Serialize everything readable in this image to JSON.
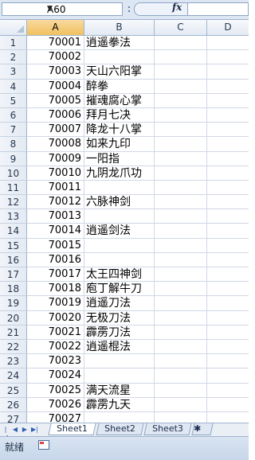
{
  "name_box": {
    "value": "A60"
  },
  "formula_bar": {
    "fx_label": "fx",
    "value": ""
  },
  "columns": [
    "A",
    "B",
    "C",
    "D"
  ],
  "selected_column": "A",
  "rows": [
    {
      "num": "1",
      "a": "70001",
      "b": "逍遥拳法"
    },
    {
      "num": "2",
      "a": "70002",
      "b": ""
    },
    {
      "num": "3",
      "a": "70003",
      "b": "天山六阳掌"
    },
    {
      "num": "4",
      "a": "70004",
      "b": "醉拳"
    },
    {
      "num": "5",
      "a": "70005",
      "b": "摧魂腐心掌"
    },
    {
      "num": "6",
      "a": "70006",
      "b": "拜月七决"
    },
    {
      "num": "7",
      "a": "70007",
      "b": "降龙十八掌"
    },
    {
      "num": "8",
      "a": "70008",
      "b": "如来九印"
    },
    {
      "num": "9",
      "a": "70009",
      "b": "一阳指"
    },
    {
      "num": "10",
      "a": "70010",
      "b": "九阴龙爪功"
    },
    {
      "num": "11",
      "a": "70011",
      "b": ""
    },
    {
      "num": "12",
      "a": "70012",
      "b": "六脉神剑"
    },
    {
      "num": "13",
      "a": "70013",
      "b": ""
    },
    {
      "num": "14",
      "a": "70014",
      "b": "逍遥剑法"
    },
    {
      "num": "15",
      "a": "70015",
      "b": ""
    },
    {
      "num": "16",
      "a": "70016",
      "b": ""
    },
    {
      "num": "17",
      "a": "70017",
      "b": "太王四神剑"
    },
    {
      "num": "18",
      "a": "70018",
      "b": "庖丁解牛刀"
    },
    {
      "num": "19",
      "a": "70019",
      "b": "逍遥刀法"
    },
    {
      "num": "20",
      "a": "70020",
      "b": "无极刀法"
    },
    {
      "num": "21",
      "a": "70021",
      "b": "霹雳刀法"
    },
    {
      "num": "22",
      "a": "70022",
      "b": "逍遥棍法"
    },
    {
      "num": "23",
      "a": "70023",
      "b": ""
    },
    {
      "num": "24",
      "a": "70024",
      "b": ""
    },
    {
      "num": "25",
      "a": "70025",
      "b": "满天流星"
    },
    {
      "num": "26",
      "a": "70026",
      "b": "霹雳九天"
    },
    {
      "num": "27",
      "a": "70027",
      "b": ""
    }
  ],
  "sheet_tabs": [
    "Sheet1",
    "Sheet2",
    "Sheet3"
  ],
  "active_tab": "Sheet1",
  "status": {
    "text": "就绪"
  },
  "icons": {
    "tab_nav": [
      "nav-first-icon",
      "nav-prev-icon",
      "nav-next-icon",
      "nav-last-icon"
    ],
    "insert_sheet": "insert-sheet-icon",
    "macro": "macro-record-icon"
  },
  "colors": {
    "selected_header": "#f1c15f",
    "header_bg": "#e4eaf3",
    "grid_line": "#d0d7e5"
  }
}
